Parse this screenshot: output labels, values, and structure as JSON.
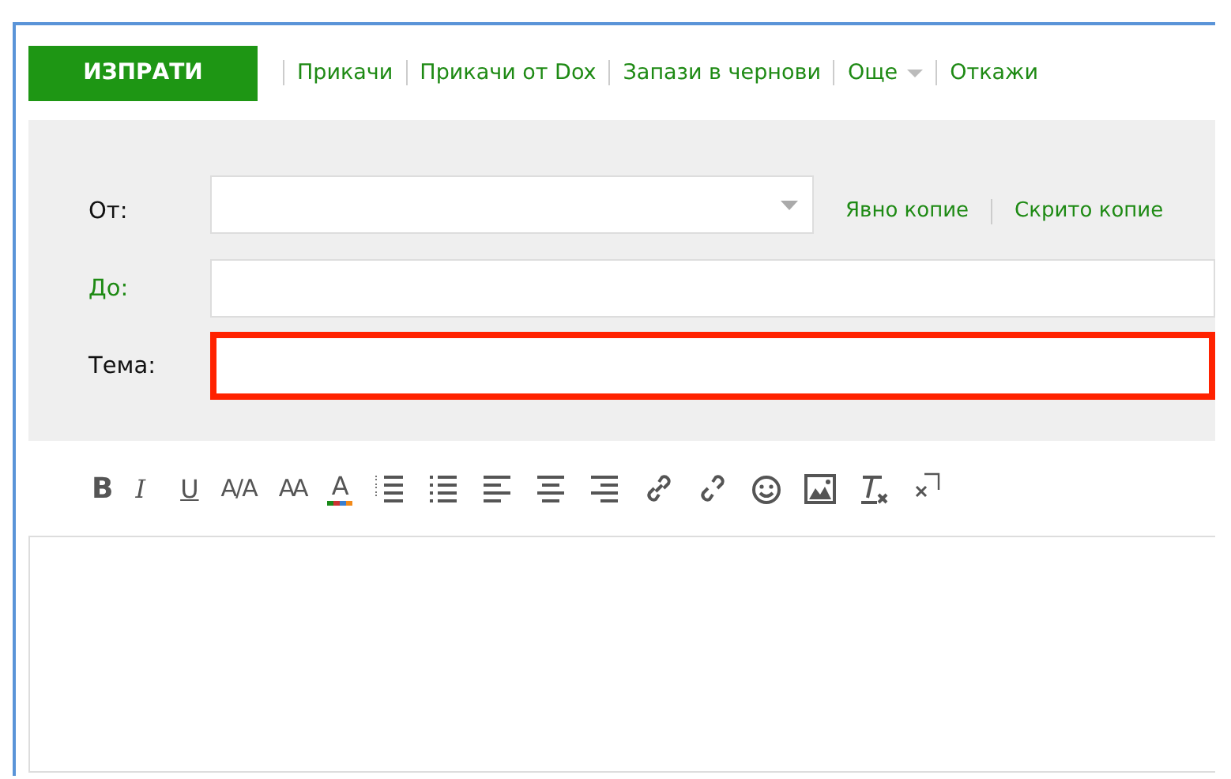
{
  "actions": {
    "send": "ИЗПРАТИ",
    "links": [
      {
        "label": "Прикачи",
        "dropdown": false
      },
      {
        "label": "Прикачи от Dox",
        "dropdown": false
      },
      {
        "label": "Запази в чернови",
        "dropdown": false
      },
      {
        "label": "Още",
        "dropdown": true
      },
      {
        "label": "Откажи",
        "dropdown": false
      }
    ]
  },
  "fields": [
    {
      "kind": "select",
      "label": "От:",
      "label_link": false,
      "highlighted": false,
      "extras": [
        "Явно копие",
        "Скрито копие"
      ]
    },
    {
      "kind": "text",
      "label": "До:",
      "label_link": true,
      "highlighted": false
    },
    {
      "kind": "text",
      "label": "Тема:",
      "label_link": false,
      "highlighted": true
    }
  ],
  "format_toolbar": [
    "B",
    "I",
    "U",
    "A/A",
    "AA",
    "A"
  ]
}
